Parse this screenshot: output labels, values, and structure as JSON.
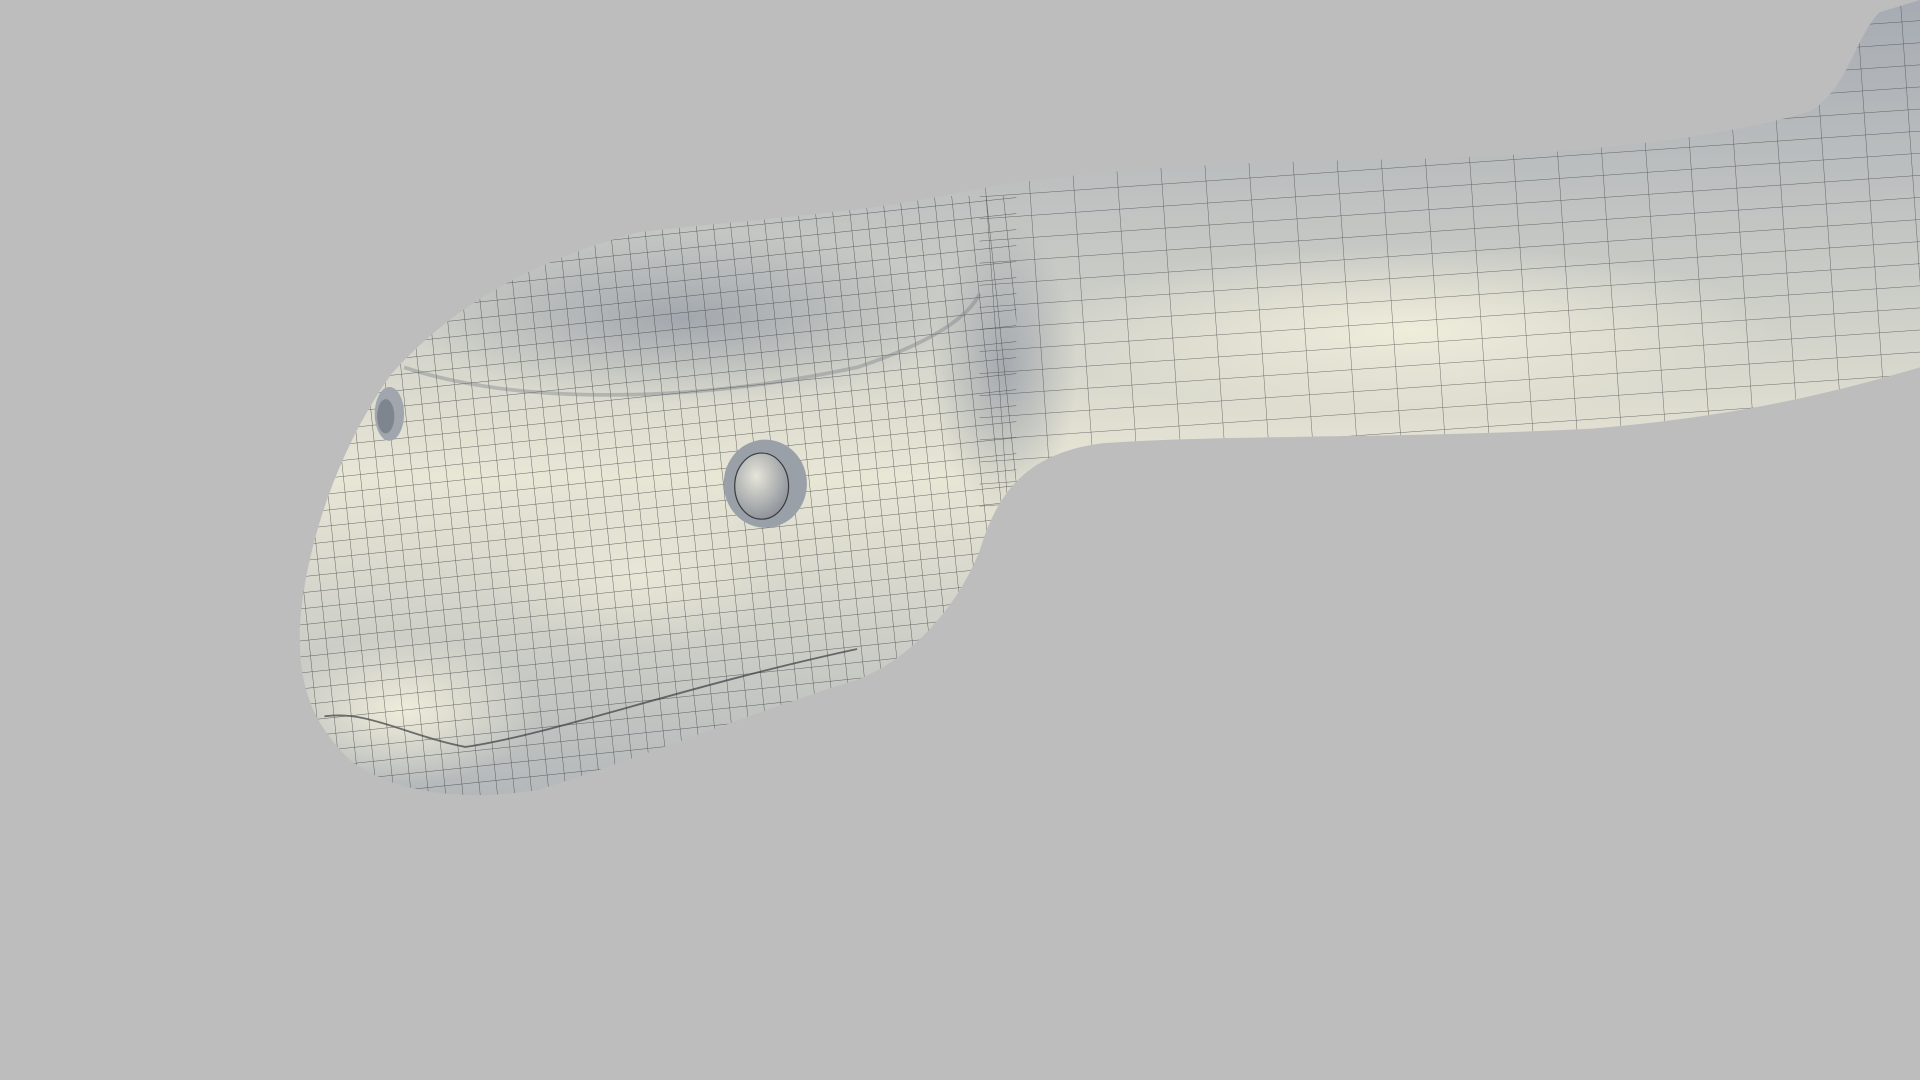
{
  "scene": {
    "subject": "snake",
    "colors": {
      "background": "#bdbdbd",
      "skin_light": "#ecead8",
      "skin_mid": "#cfd0c8",
      "skin_shadow": "#9ea4ad",
      "wire": "#3a3d40"
    }
  }
}
